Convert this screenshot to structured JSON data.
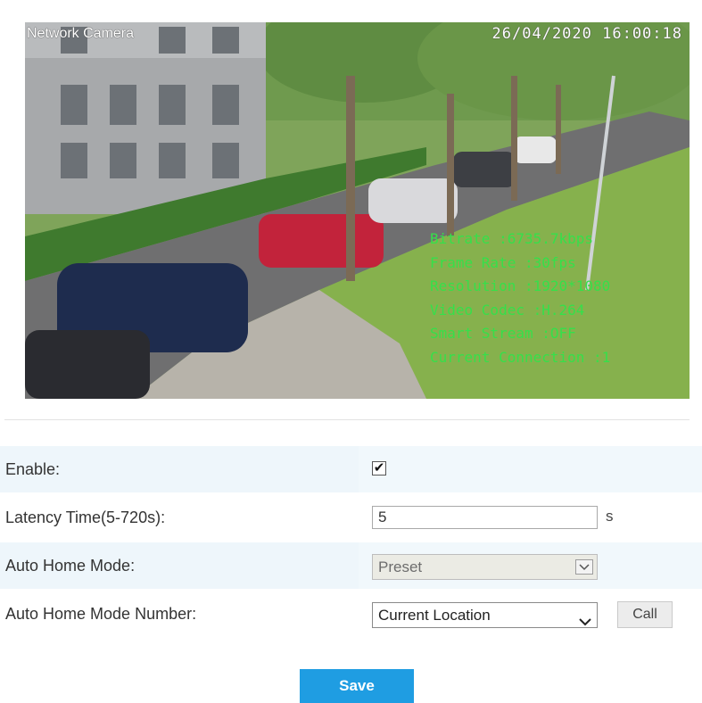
{
  "video": {
    "camera_name": "Network Camera",
    "timestamp": "26/04/2020 16:00:18",
    "stats": [
      "Bitrate :6735.7kbps",
      "Frame Rate :30fps",
      "Resolution :1920*1080",
      "Video Codec :H.264",
      "Smart Stream :OFF",
      "Current Connection :1"
    ],
    "stats_color": "#35e04a"
  },
  "form": {
    "enable": {
      "label": "Enable:",
      "checked": true,
      "check_glyph": "✔"
    },
    "latency": {
      "label": "Latency Time(5-720s):",
      "value": "5",
      "unit": "s"
    },
    "auto_home_mode": {
      "label": "Auto Home Mode:",
      "selected": "Preset",
      "disabled": true
    },
    "auto_home_number": {
      "label": "Auto Home Mode Number:",
      "selected": "Current Location",
      "call_label": "Call"
    }
  },
  "save_label": "Save",
  "colors": {
    "accent": "#1f9de2",
    "row_shade": "#eef6fb"
  }
}
